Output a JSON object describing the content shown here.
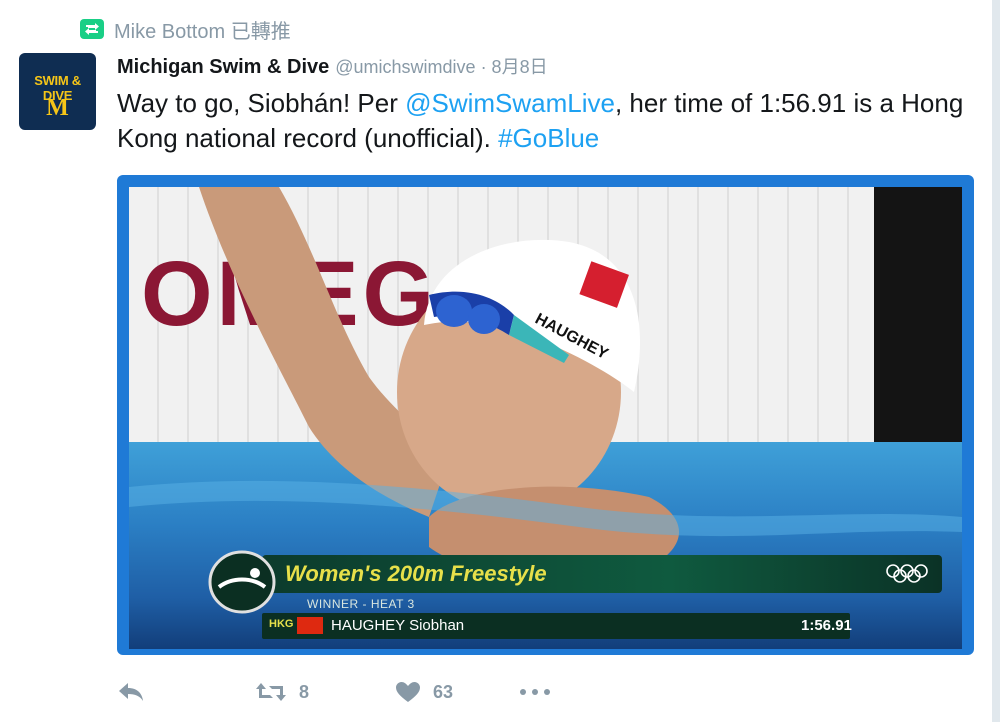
{
  "retweet_context": {
    "icon": "retweet-icon",
    "text": "Mike Bottom 已轉推"
  },
  "tweet": {
    "avatar": {
      "icon": "avatar-logo",
      "line1": "SWIM & DIVE",
      "line2": "M"
    },
    "display_name": "Michigan Swim & Dive",
    "handle_and_date": "@umichswimdive · 8月8日",
    "text": {
      "part1": "Way to go, Siobhán! Per ",
      "mention": "@SwimSwamLive",
      "part2": ", her time of 1:56.91 is a Hong Kong national record (unofficial). ",
      "hashtag": "#GoBlue"
    },
    "media": {
      "overlay_event": "Women's 200m Freestyle",
      "overlay_subtitle": "WINNER - HEAT 3",
      "overlay_country": "HKG",
      "overlay_athlete": "HAUGHEY Siobhan",
      "overlay_time": "1:56.91",
      "background_text": "OMEGA",
      "cap_text": "HAUGHEY"
    },
    "actions": {
      "reply_icon": "reply-icon",
      "retweet_icon": "retweet-icon",
      "retweet_count": "8",
      "like_icon": "heart-icon",
      "like_count": "63",
      "more_icon": "more-icon"
    }
  },
  "colors": {
    "link": "#1da1f2",
    "muted": "#8899a6",
    "retweet_green": "#19cf86",
    "media_border": "#1f7ad6"
  }
}
